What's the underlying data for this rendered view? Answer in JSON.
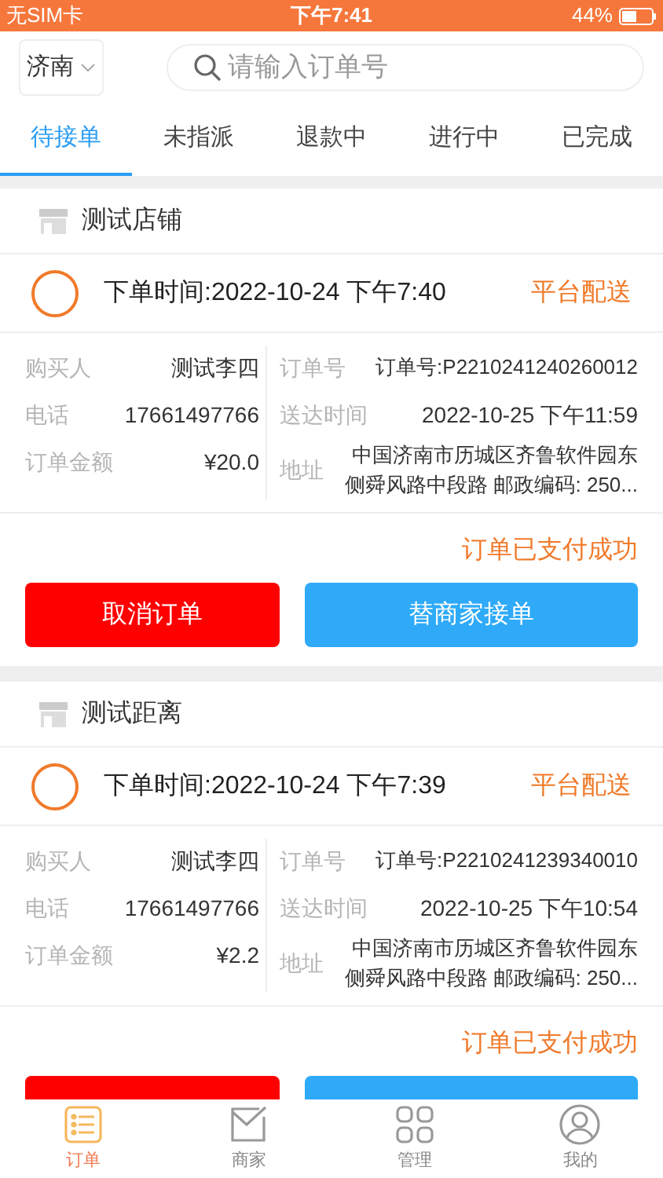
{
  "status_bar": {
    "carrier": "无SIM卡",
    "time": "下午7:41",
    "battery": "44%"
  },
  "header": {
    "city": "济南",
    "search": {
      "placeholder": "请输入订单号"
    }
  },
  "tabs": [
    {
      "label": "待接单",
      "selected": true
    },
    {
      "label": "未指派",
      "selected": false
    },
    {
      "label": "退款中",
      "selected": false
    },
    {
      "label": "进行中",
      "selected": false
    },
    {
      "label": "已完成",
      "selected": false
    }
  ],
  "orders": [
    {
      "shop": "测试店铺",
      "order_time": "下单时间:2022-10-24 下午7:40",
      "delivery": "平台配送",
      "buyer_label": "购买人",
      "buyer": "测试李四",
      "phone_label": "电话",
      "phone": "17661497766",
      "amount_label": "订单金额",
      "amount": "¥20.0",
      "order_no_label": "订单号",
      "order_no": "订单号:P2210241240260012",
      "deliver_time_label": "送达时间",
      "deliver_time": "2022-10-25 下午11:59",
      "address_label": "地址",
      "address": "中国济南市历城区齐鲁软件园东侧舜风路中段路 邮政编码: 250...",
      "status": "订单已支付成功",
      "buttons": [
        "取消订单",
        "替商家接单"
      ]
    },
    {
      "shop": "测试距离",
      "order_time": "下单时间:2022-10-24 下午7:39",
      "delivery": "平台配送",
      "buyer_label": "购买人",
      "buyer": "测试李四",
      "phone_label": "电话",
      "phone": "17661497766",
      "amount_label": "订单金额",
      "amount": "¥2.2",
      "order_no_label": "订单号",
      "order_no": "订单号:P2210241239340010",
      "deliver_time_label": "送达时间",
      "deliver_time": "2022-10-25 下午10:54",
      "address_label": "地址",
      "address": "中国济南市历城区齐鲁软件园东侧舜风路中段路 邮政编码: 250...",
      "status": "订单已支付成功"
    }
  ],
  "tab_bar": [
    {
      "label": "订单",
      "selected": true
    },
    {
      "label": "商家",
      "selected": false
    },
    {
      "label": "管理",
      "selected": false
    },
    {
      "label": "我的",
      "selected": false
    }
  ]
}
